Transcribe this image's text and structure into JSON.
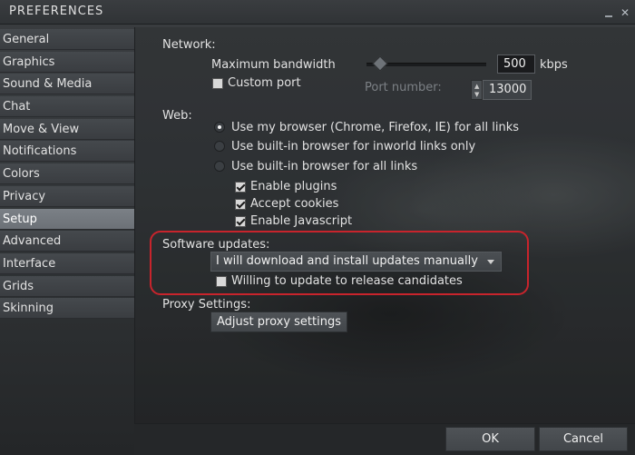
{
  "window": {
    "title": "PREFERENCES"
  },
  "sidebar": {
    "items": [
      {
        "label": "General"
      },
      {
        "label": "Graphics"
      },
      {
        "label": "Sound & Media"
      },
      {
        "label": "Chat"
      },
      {
        "label": "Move & View"
      },
      {
        "label": "Notifications"
      },
      {
        "label": "Colors"
      },
      {
        "label": "Privacy"
      },
      {
        "label": "Setup",
        "active": true
      },
      {
        "label": "Advanced"
      },
      {
        "label": "Interface"
      },
      {
        "label": "Grids"
      },
      {
        "label": "Skinning"
      }
    ]
  },
  "network": {
    "heading": "Network:",
    "bandwidth_label": "Maximum bandwidth",
    "bandwidth_value": "500",
    "bandwidth_unit": "kbps",
    "custom_port_label": "Custom port",
    "custom_port_checked": false,
    "port_label": "Port number:",
    "port_value": "13000"
  },
  "web": {
    "heading": "Web:",
    "options": [
      {
        "label": "Use my browser (Chrome, Firefox, IE) for all links",
        "selected": true
      },
      {
        "label": "Use built-in browser for inworld links only",
        "selected": false
      },
      {
        "label": "Use built-in browser for all links",
        "selected": false
      }
    ],
    "checkboxes": [
      {
        "label": "Enable plugins",
        "checked": true
      },
      {
        "label": "Accept cookies",
        "checked": true
      },
      {
        "label": "Enable Javascript",
        "checked": true
      }
    ]
  },
  "software_updates": {
    "heading": "Software updates:",
    "selected_option": "I will download and install updates manually",
    "release_candidates_label": "Willing to update to release candidates",
    "release_candidates_checked": false
  },
  "proxy": {
    "heading": "Proxy Settings:",
    "button_label": "Adjust proxy settings"
  },
  "footer": {
    "ok_label": "OK",
    "cancel_label": "Cancel"
  },
  "colors": {
    "highlight": "#c8242c",
    "active_tab": "#7b8086"
  }
}
